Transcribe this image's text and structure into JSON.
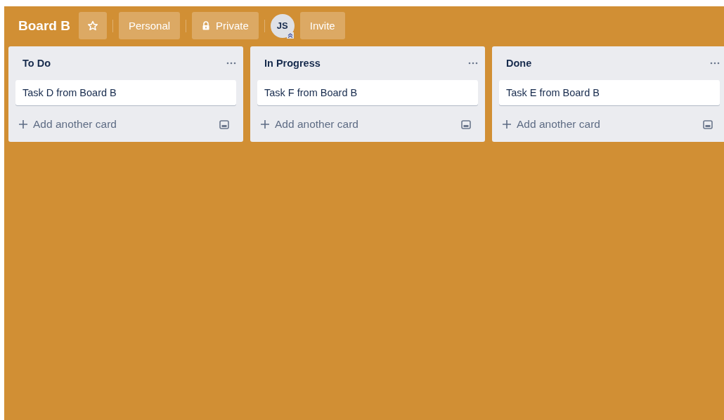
{
  "board": {
    "title": "Board B",
    "team": "Personal",
    "visibility": "Private",
    "avatar": "JS",
    "invite": "Invite"
  },
  "lists": [
    {
      "title": "To Do",
      "cards": [
        "Task D from Board B"
      ],
      "add": "Add another card"
    },
    {
      "title": "In Progress",
      "cards": [
        "Task F from Board B"
      ],
      "add": "Add another card"
    },
    {
      "title": "Done",
      "cards": [
        "Task E from Board B"
      ],
      "add": "Add another card"
    }
  ]
}
